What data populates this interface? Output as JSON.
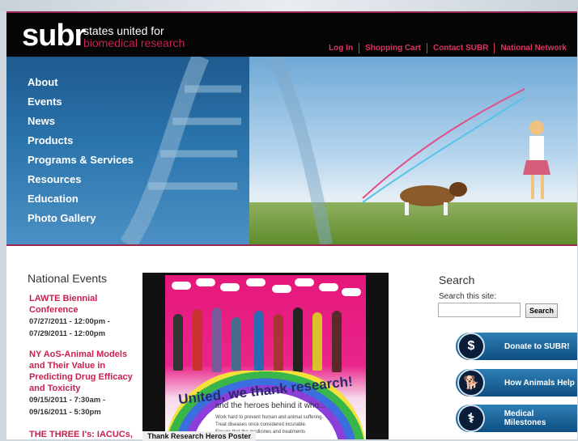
{
  "header": {
    "logo": "subr",
    "tagline_line1": "states united for",
    "tagline_line2": "biomedical research",
    "links": [
      "Log In",
      "Shopping Cart",
      "Contact SUBR",
      "National Network"
    ]
  },
  "nav": [
    "About",
    "Events",
    "News",
    "Products",
    "Programs & Services",
    "Resources",
    "Education",
    "Photo Gallery"
  ],
  "events": {
    "title": "National Events",
    "items": [
      {
        "title": "LAWTE Biennial Conference",
        "dates": [
          "07/27/2011 - 12:00pm -",
          "07/29/2011 - 12:00pm"
        ]
      },
      {
        "title": "NY AoS-Animal Models and Their Value in Predicting Drug Efficacy and Toxicity",
        "dates": [
          "09/15/2011 - 7:30am -",
          "09/16/2011 - 5:30pm"
        ]
      },
      {
        "title": "THE THREE I's: IACUCs,",
        "dates": []
      }
    ]
  },
  "poster": {
    "title": "United, we thank research!",
    "subtitle": "and the heroes behind it who...",
    "bullets": [
      "Work hard to prevent human and animal suffering.",
      "Treat diseases once considered incurable.",
      "Ensure that the medicines and treatments"
    ],
    "caption": "Thank Research Heros Poster"
  },
  "search": {
    "title": "Search",
    "label": "Search this site:",
    "value": "",
    "button": "Search"
  },
  "actions": [
    {
      "label": "Donate to SUBR!",
      "icon": "dollar-hand-icon",
      "glyph": "$"
    },
    {
      "label": "How Animals Help",
      "icon": "dog-icon",
      "glyph": "🐕"
    },
    {
      "label": "Medical Milestones",
      "icon": "caduceus-icon",
      "glyph": "⚕"
    }
  ],
  "colors": {
    "accent": "#c8214e",
    "header_bg": "#050505",
    "pill": "#1a5f93"
  }
}
